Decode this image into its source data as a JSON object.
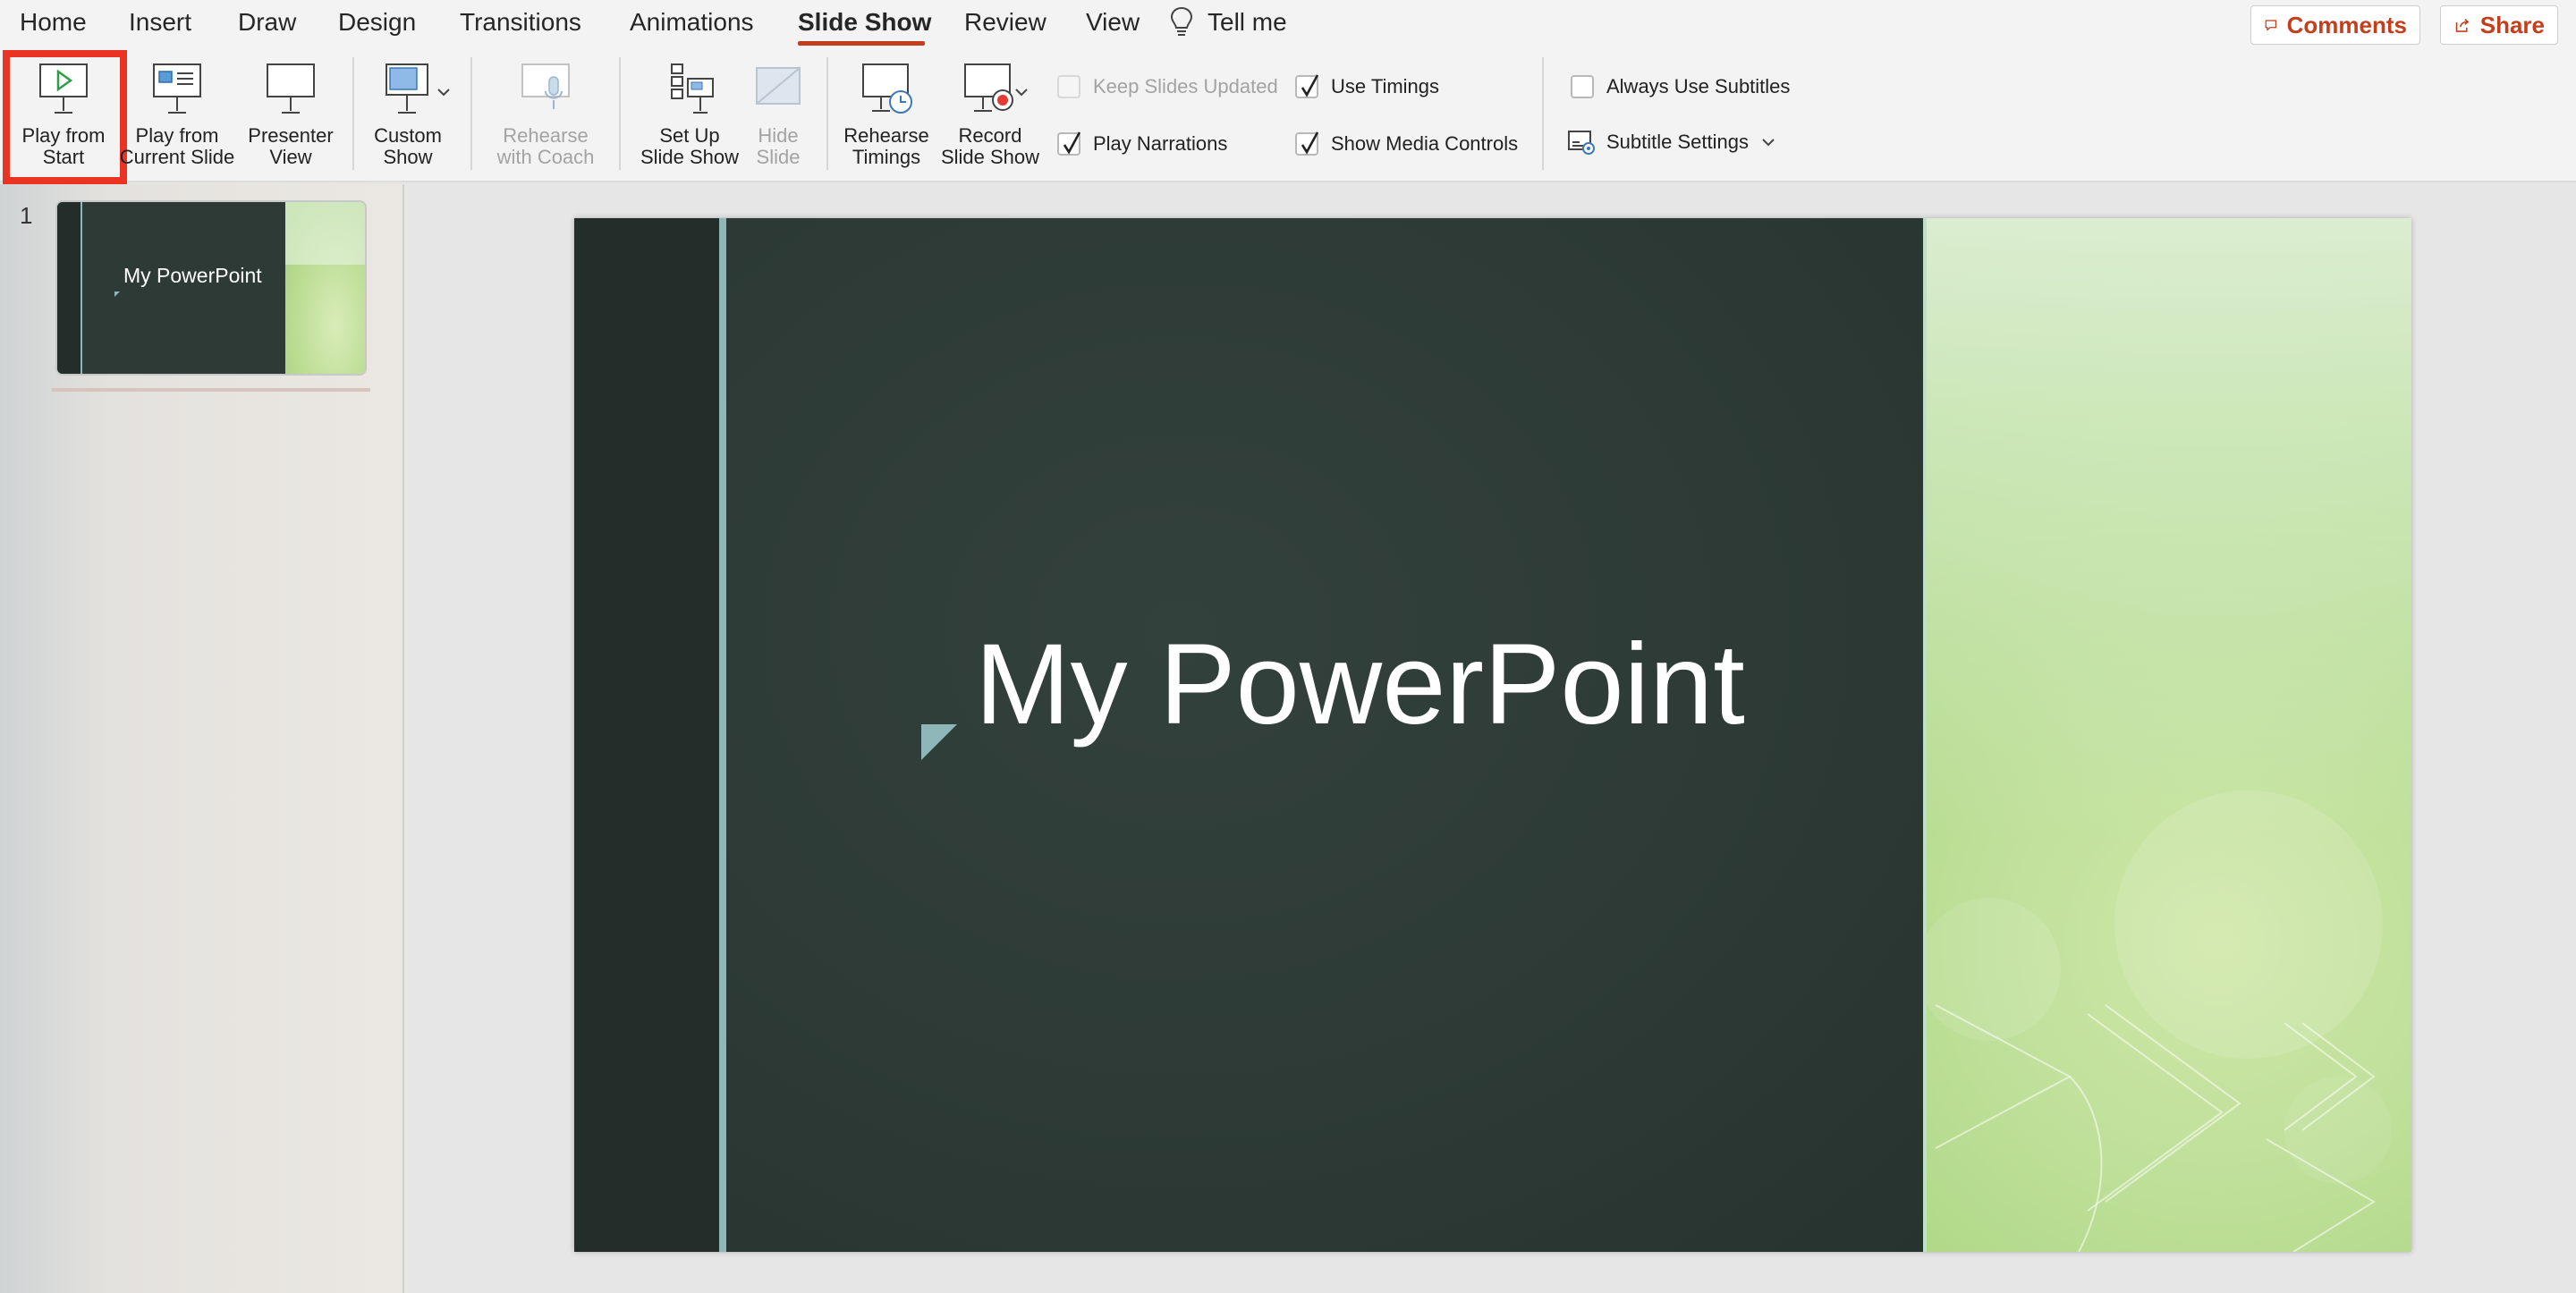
{
  "tabs": [
    {
      "label": "Home",
      "active": false
    },
    {
      "label": "Insert",
      "active": false
    },
    {
      "label": "Draw",
      "active": false
    },
    {
      "label": "Design",
      "active": false
    },
    {
      "label": "Transitions",
      "active": false
    },
    {
      "label": "Animations",
      "active": false
    },
    {
      "label": "Slide Show",
      "active": true
    },
    {
      "label": "Review",
      "active": false
    },
    {
      "label": "View",
      "active": false
    }
  ],
  "tell_me": "Tell me",
  "comments_label": "Comments",
  "share_label": "Share",
  "ribbon": {
    "play_from_start": [
      "Play from",
      "Start"
    ],
    "play_from_current": [
      "Play from",
      "Current Slide"
    ],
    "presenter_view": [
      "Presenter",
      "View"
    ],
    "custom_show": [
      "Custom",
      "Show"
    ],
    "rehearse_coach": [
      "Rehearse",
      "with Coach"
    ],
    "setup_show": [
      "Set Up",
      "Slide Show"
    ],
    "hide_slide": [
      "Hide",
      "Slide"
    ],
    "rehearse_timings": [
      "Rehearse",
      "Timings"
    ],
    "record_show": [
      "Record",
      "Slide Show"
    ],
    "keep_slides_updated": "Keep Slides Updated",
    "play_narrations": "Play Narrations",
    "use_timings": "Use Timings",
    "show_media_controls": "Show Media Controls",
    "always_use_subtitles": "Always Use Subtitles",
    "subtitle_settings": "Subtitle Settings"
  },
  "checkbox_states": {
    "keep_slides_updated": false,
    "play_narrations": true,
    "use_timings": true,
    "show_media_controls": true,
    "always_use_subtitles": false
  },
  "colors": {
    "accent": "#c43e1c",
    "highlight": "#ea3323",
    "slide_dark": "#2d3a36",
    "slide_green": "#a8d47c"
  },
  "thumbnails": [
    {
      "number": "1",
      "title": "My PowerPoint"
    }
  ],
  "slide": {
    "title": "My PowerPoint"
  }
}
